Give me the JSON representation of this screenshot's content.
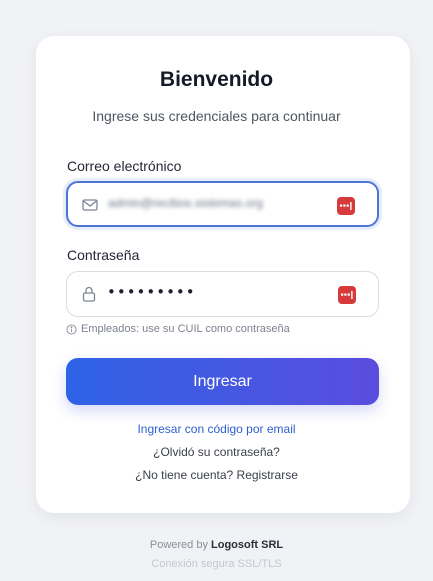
{
  "login": {
    "title": "Bienvenido",
    "subtitle": "Ingrese sus credenciales para continuar",
    "email": {
      "label": "Correo electrónico",
      "value": "admin@recibos.sistemas.org",
      "icon": "mail-icon"
    },
    "password": {
      "label": "Contraseña",
      "value": "•••••••••",
      "icon": "lock-icon"
    },
    "password_manager_icon": "password-manager-icon",
    "hint": "Empleados: use su CUIL como contraseña",
    "hint_icon": "info-icon",
    "submit_label": "Ingresar",
    "links": {
      "email_code": "Ingresar con código por email",
      "forgot": "¿Olvidó su contraseña?",
      "register": "¿No tiene cuenta? Registrarse"
    }
  },
  "footer": {
    "powered_prefix": "Powered by",
    "company": "Logosoft SRL",
    "secure": "Conexión segura SSL/TLS"
  },
  "colors": {
    "accent": "#2e63e6",
    "accent_end": "#5a4dde",
    "link": "#2d5fd0",
    "password_manager": "#d63a3a"
  }
}
